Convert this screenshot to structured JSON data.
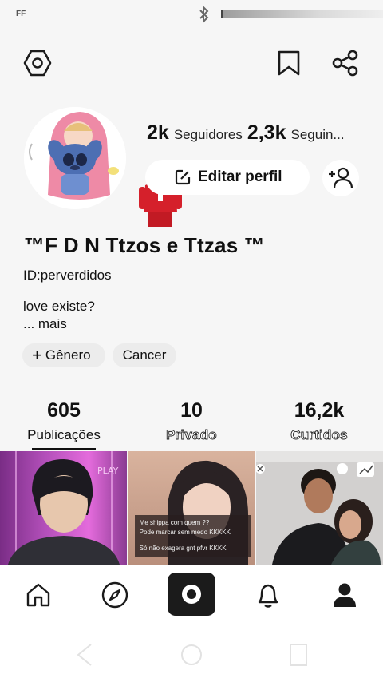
{
  "status_bar": {
    "app_tag": "FF"
  },
  "profile": {
    "followers_count": "2k",
    "followers_label": "Seguidores",
    "following_count": "2,3k",
    "following_label": "Seguin...",
    "edit_label": "Editar perfil",
    "name": "™F D N Ttzos e Ttzas ™",
    "id": "ID:perverdidos",
    "bio": "love existe?",
    "bio_more": "...  mais",
    "chips": {
      "genero": "Gênero",
      "cancer": "Cancer"
    }
  },
  "counters": [
    {
      "value": "605",
      "label": "Publicações"
    },
    {
      "value": "10",
      "label": "Privado"
    },
    {
      "value": "16,2k",
      "label": "Curtidos"
    }
  ],
  "grid": {
    "caption_line1": "Me shippa com quem ??",
    "caption_line2": "Pode marcar sem medo KKKKK",
    "caption_line3": "Só não exagera gnt pfvr KKKK",
    "watermark": "PLAY"
  },
  "icons": {
    "settings": "hexagon-settings-icon",
    "bookmark": "bookmark-icon",
    "share": "share-icon",
    "add_friend": "add-friend-icon",
    "home": "home-icon",
    "explore": "compass-icon",
    "camera": "camera-icon",
    "notifications": "bell-icon",
    "profile": "person-icon"
  }
}
